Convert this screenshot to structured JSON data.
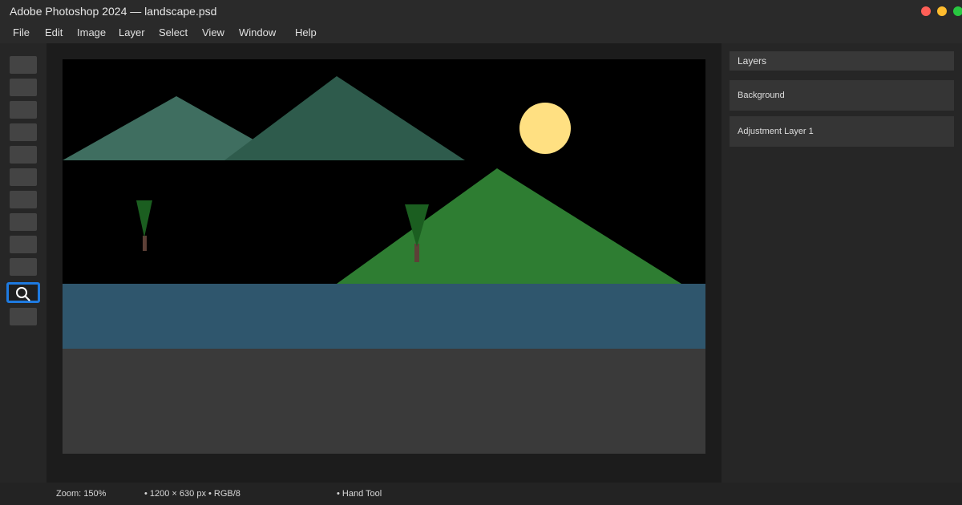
{
  "window": {
    "title": "Adobe Photoshop 2024 — landscape.psd"
  },
  "menu": {
    "items": [
      "File",
      "Edit",
      "Image",
      "Layer",
      "Select",
      "View",
      "Window",
      "Help"
    ]
  },
  "tools": {
    "active_tool": "zoom-tool",
    "active_icon": "magnifier-icon",
    "accent_color": "#1e7ae0"
  },
  "canvas": {
    "scene": {
      "sky_color": "#000000",
      "sun_color": "#ffe082",
      "mountain_back_left_color": "#3f6e60",
      "mountain_back_right_color": "#2e5b4c",
      "hill_color": "#2e7d32",
      "tree_color": "#1b5e20",
      "trunk_color": "#5d4037",
      "water_color": "#2f566d",
      "ground_color": "#3a3a3a"
    }
  },
  "layers_panel": {
    "title": "Layers",
    "layers": [
      "Background",
      "Adjustment Layer 1"
    ]
  },
  "status": {
    "zoom": "Zoom: 150%",
    "dimensions": "• 1200 × 630 px • RGB/8",
    "tool": "• Hand Tool"
  }
}
